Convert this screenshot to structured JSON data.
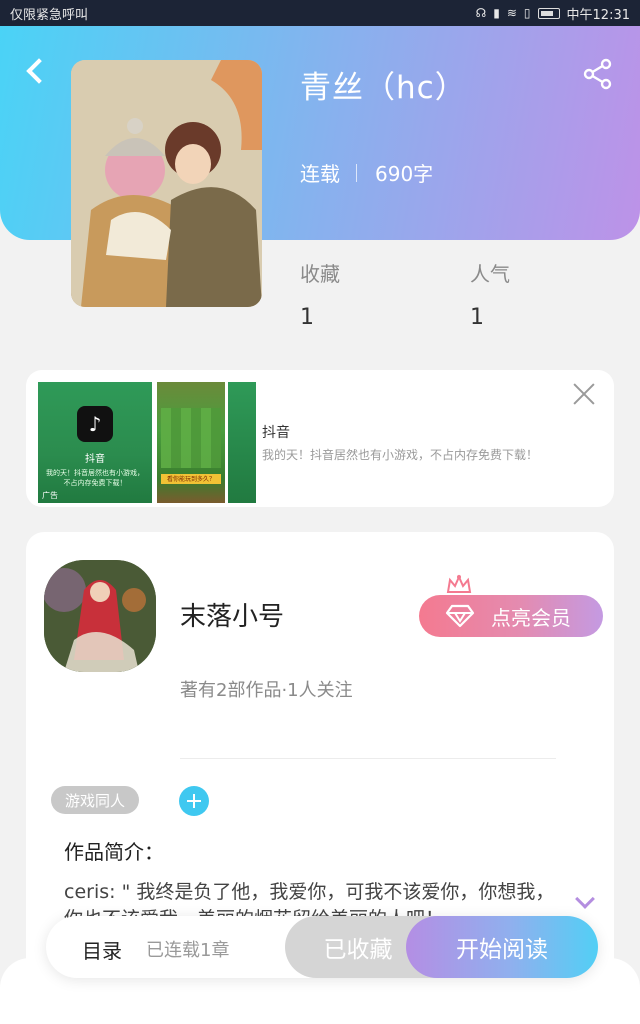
{
  "status_bar": {
    "left_text": "仅限紧急呼叫",
    "time": "中午12:31",
    "icons": [
      "headphones-icon",
      "vibrate-icon",
      "wifi-icon",
      "sim-icon",
      "battery-icon"
    ]
  },
  "header": {
    "back_icon": "back-arrow-icon",
    "share_icon": "share-icon",
    "gradient": [
      "#4ad3f6",
      "#86b2ee",
      "#bd92e8"
    ]
  },
  "book": {
    "title": "青丝（hc）",
    "status": "连载",
    "word_count": "690字"
  },
  "stats": [
    {
      "label": "收藏",
      "value": "1"
    },
    {
      "label": "人气",
      "value": "1"
    }
  ],
  "ad": {
    "thumb_app_name": "抖音",
    "thumb_desc": "我的天！抖音居然也有小游戏，不占内存免费下载！",
    "thumb_tag": "广告",
    "thumb_game_banner": "看你能玩到多久？",
    "title": "抖音",
    "description": "我的天！抖音居然也有小游戏，不占内存免费下载！"
  },
  "author": {
    "name": "末落小号",
    "summary": "著有2部作品·1人关注",
    "vip_label": "点亮会员"
  },
  "tags": [
    {
      "label": "游戏同人"
    }
  ],
  "intro": {
    "title": "作品简介：",
    "text": "ceris: \" 我终是负了他，我爱你，可我不该爱你，你想我，你也不该爱我，美丽的烟花留给美丽的人吧！"
  },
  "bottom_bar": {
    "catalog_label": "目录",
    "catalog_sub": "已连载1章",
    "collected_label": "已收藏",
    "read_label": "开始阅读"
  },
  "colors": {
    "accent_blue": "#3fc8f0",
    "accent_purple": "#b48ee0",
    "vip_pink": "#f47a90"
  }
}
